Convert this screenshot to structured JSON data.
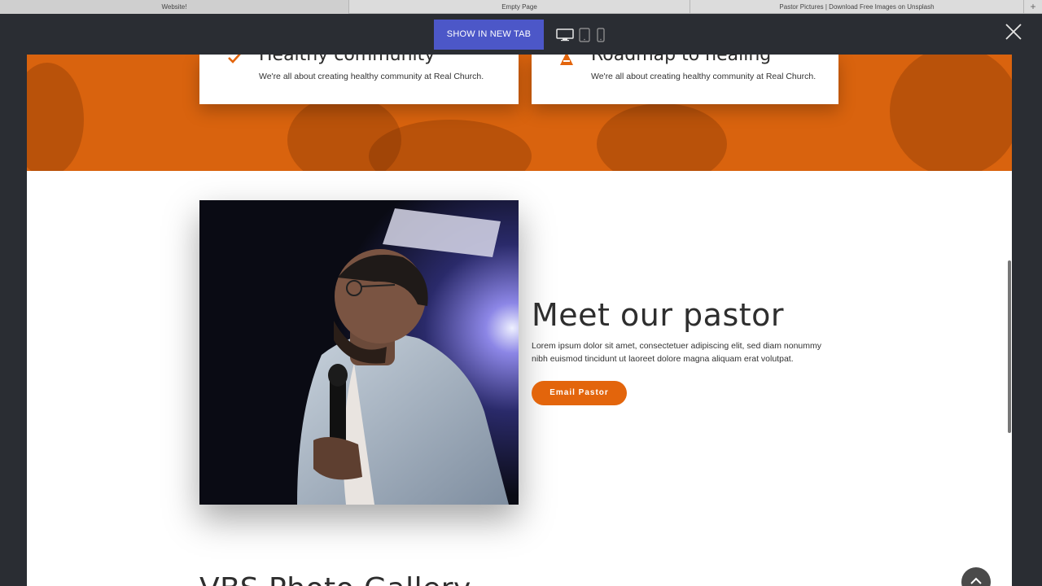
{
  "browser": {
    "tabs": [
      {
        "label": "Website!"
      },
      {
        "label": "Empty Page"
      },
      {
        "label": "Pastor Pictures | Download Free Images on Unsplash"
      }
    ],
    "new_tab_label": "+"
  },
  "toolbar": {
    "show_new_tab_label": "SHOW IN NEW TAB",
    "devices": [
      "desktop-icon",
      "tablet-icon",
      "mobile-icon"
    ],
    "close_icon": "close-icon"
  },
  "colors": {
    "accent_orange": "#e3650c",
    "button_blue": "#4c57c8",
    "dark_chrome": "#2a2d33"
  },
  "features": [
    {
      "title": "Healthy community",
      "text": "We're all about creating healthy community at Real Church.",
      "icon": "check-icon"
    },
    {
      "title": "Roadmap to healing",
      "text": "We're all about creating healthy community at Real Church.",
      "icon": "triangle-icon"
    }
  ],
  "pastor": {
    "heading": "Meet our pastor",
    "body": "Lorem ipsum dolor sit amet, consectetuer adipiscing elit, sed diam nonummy nibh euismod tincidunt ut laoreet dolore magna aliquam erat volutpat.",
    "button_label": "Email Pastor"
  },
  "gallery": {
    "heading": "VBS Photo Gallery"
  }
}
